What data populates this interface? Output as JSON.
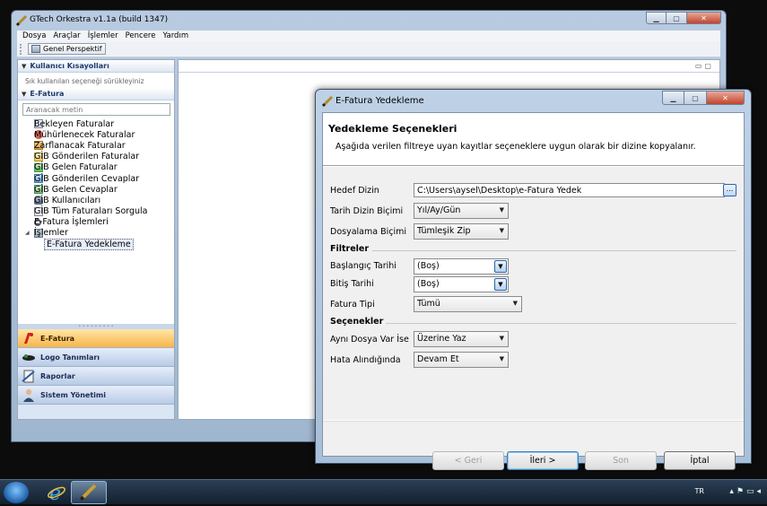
{
  "main_window": {
    "title": "GTech Orkestra v1.1a (build 1347)",
    "menu": [
      "Dosya",
      "Araçlar",
      "İşlemler",
      "Pencere",
      "Yardım"
    ],
    "toolbar": {
      "perspective_label": "Genel Perspektif"
    }
  },
  "left_panel": {
    "shortcuts_header": "Kullanıcı Kısayolları",
    "shortcuts_hint": "Sık kullanılan seçeneği sürükleyiniz",
    "efatura_header": "E-Fatura",
    "search_placeholder": "Aranacak metin",
    "tree": [
      {
        "label": "Bekleyen Faturalar",
        "icon": "document-icon"
      },
      {
        "label": "Mühürlenecek Faturalar",
        "icon": "seal-icon"
      },
      {
        "label": "Zarflanacak Faturalar",
        "icon": "envelope-icon"
      },
      {
        "label": "GİB Gönderilen Faturalar",
        "icon": "send-icon"
      },
      {
        "label": "GİB Gelen Faturalar",
        "icon": "inbox-icon"
      },
      {
        "label": "GİB Gönderilen Cevaplar",
        "icon": "reply-sent-icon"
      },
      {
        "label": "GİB Gelen Cevaplar",
        "icon": "reply-received-icon"
      },
      {
        "label": "GİB Kullanıcıları",
        "icon": "users-icon"
      },
      {
        "label": "GİB Tüm Faturaları Sorgula",
        "icon": "query-icon"
      },
      {
        "label": "E-Fatura İşlemleri",
        "icon": "search-icon"
      },
      {
        "label": "İşlemler",
        "icon": "folder-icon"
      },
      {
        "label": "E-Fatura Yedekleme",
        "icon": "backup-icon"
      }
    ],
    "outlook_buttons": [
      {
        "label": "E-Fatura",
        "icon": "efatura-logo-icon"
      },
      {
        "label": "Logo Tanımları",
        "icon": "logo-icon"
      },
      {
        "label": "Raporlar",
        "icon": "report-icon"
      },
      {
        "label": "Sistem Yönetimi",
        "icon": "admin-user-icon"
      }
    ]
  },
  "dialog": {
    "title": "E-Fatura Yedekleme",
    "heading": "Yedekleme Seçenekleri",
    "description": "Aşağıda verilen filtreye uyan kayıtlar seçeneklere uygun olarak bir dizine kopyalanır.",
    "fields": {
      "hedef_dizin_label": "Hedef Dizin",
      "hedef_dizin_value": "C:\\Users\\aysel\\Desktop\\e-Fatura Yedek",
      "browse_label": "...",
      "tarih_dizin_label": "Tarih Dizin Biçimi",
      "tarih_dizin_value": "Yıl/Ay/Gün",
      "dosyalama_label": "Dosyalama Biçimi",
      "dosyalama_value": "Tümleşik Zip",
      "filtreler_group": "Filtreler",
      "baslangic_label": "Başlangıç Tarihi",
      "baslangic_value": "(Boş)",
      "bitis_label": "Bitiş Tarihi",
      "bitis_value": "(Boş)",
      "fatura_tipi_label": "Fatura Tipi",
      "fatura_tipi_value": "Tümü",
      "secenekler_group": "Seçenekler",
      "ayni_dosya_label": "Aynı Dosya Var İse",
      "ayni_dosya_value": "Üzerine Yaz",
      "hata_label": "Hata Alındığında",
      "hata_value": "Devam Et"
    },
    "buttons": {
      "back": "< Geri",
      "next": "İleri >",
      "finish": "Son",
      "cancel": "İptal"
    }
  },
  "taskbar": {
    "language": "TR"
  }
}
